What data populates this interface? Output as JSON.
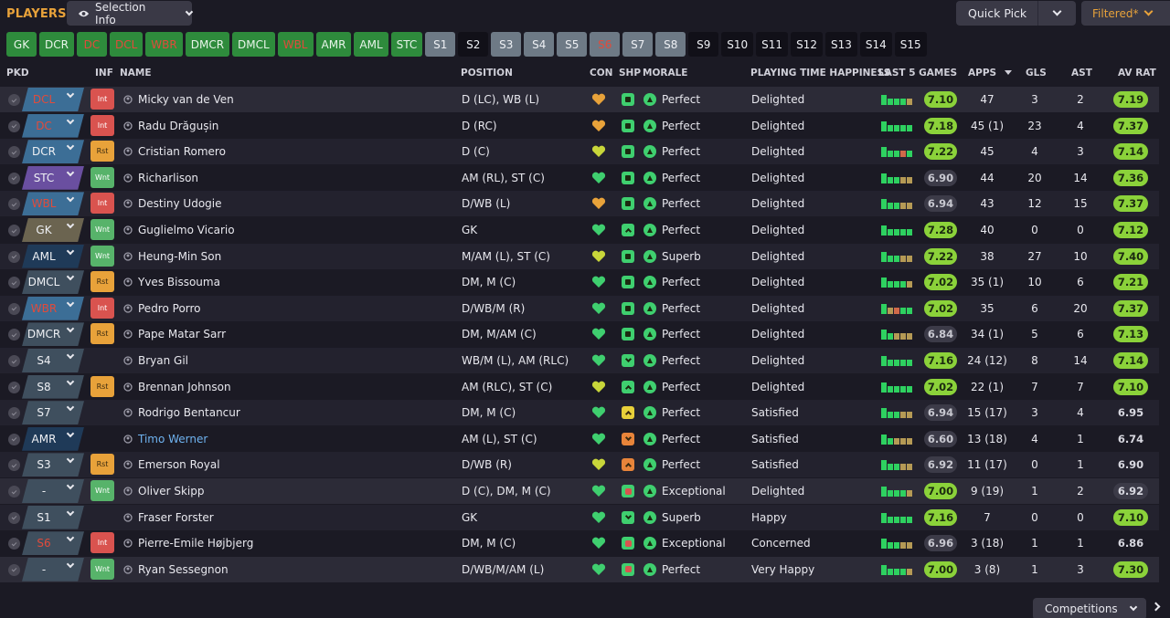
{
  "header": {
    "title": "PLAYERS",
    "selection_info": "Selection Info",
    "quick_pick": "Quick Pick",
    "filtered": "Filtered*"
  },
  "position_buttons": [
    {
      "label": "GK",
      "style": "green"
    },
    {
      "label": "DCR",
      "style": "green"
    },
    {
      "label": "DC",
      "style": "green-red"
    },
    {
      "label": "DCL",
      "style": "green-red"
    },
    {
      "label": "WBR",
      "style": "green-red"
    },
    {
      "label": "DMCR",
      "style": "green"
    },
    {
      "label": "DMCL",
      "style": "green"
    },
    {
      "label": "WBL",
      "style": "green-red"
    },
    {
      "label": "AMR",
      "style": "green"
    },
    {
      "label": "AML",
      "style": "green"
    },
    {
      "label": "STC",
      "style": "green"
    },
    {
      "label": "S1",
      "style": "grey"
    },
    {
      "label": "S2",
      "style": "dark"
    },
    {
      "label": "S3",
      "style": "grey"
    },
    {
      "label": "S4",
      "style": "grey"
    },
    {
      "label": "S5",
      "style": "grey"
    },
    {
      "label": "S6",
      "style": "grey-red"
    },
    {
      "label": "S7",
      "style": "grey"
    },
    {
      "label": "S8",
      "style": "grey"
    },
    {
      "label": "S9",
      "style": "dark"
    },
    {
      "label": "S10",
      "style": "dark"
    },
    {
      "label": "S11",
      "style": "dark"
    },
    {
      "label": "S12",
      "style": "dark"
    },
    {
      "label": "S13",
      "style": "dark"
    },
    {
      "label": "S14",
      "style": "dark"
    },
    {
      "label": "S15",
      "style": "dark"
    }
  ],
  "columns": {
    "pkd": "PKD",
    "inf": "INF",
    "name": "NAME",
    "position": "POSITION",
    "con": "CON",
    "shp": "SHP",
    "morale": "MORALE",
    "pth": "PLAYING TIME HAPPINESS",
    "last5": "LAST 5 GAMES",
    "apps": "APPS",
    "gls": "GLS",
    "ast": "AST",
    "avr": "AV RAT"
  },
  "colors": {
    "green": "#2e8b3c",
    "grey": "#6e7a86",
    "accent": "#e8a23a",
    "rating": "#8bd23a",
    "pos_blue": "#3c6e96",
    "pos_purple": "#6a4fa0",
    "pos_olive": "#6b6450",
    "pos_navy": "#1f3a58",
    "pos_dark": "#3f4f5e"
  },
  "players": [
    {
      "pos": "DCL",
      "pos_color": "#3c6e96",
      "pos_red": true,
      "inf": "Int",
      "name": "Micky van de Ven",
      "position": "D (LC), WB (L)",
      "con": "heart-orange",
      "shp": "green",
      "morale": "Perfect",
      "pth": "Delighted",
      "bars": [
        "#2ed160",
        "#2ed160",
        "#2ed160",
        "#2ed160",
        "#b59a55"
      ],
      "last5": "7.10",
      "last5_style": "green",
      "apps": "47",
      "gls": "3",
      "ast": "2",
      "avr": "7.19",
      "avr_style": "green"
    },
    {
      "pos": "DC",
      "pos_color": "#3c6e96",
      "pos_red": true,
      "inf": "Int",
      "name": "Radu Drăgușin",
      "position": "D (RC)",
      "con": "heart-orange",
      "shp": "green",
      "morale": "Perfect",
      "pth": "Delighted",
      "bars": [
        "#2ed160",
        "#2ed160",
        "#2ed160",
        "#2ed160",
        "#2ed160"
      ],
      "last5": "7.18",
      "last5_style": "green",
      "apps": "45 (1)",
      "gls": "23",
      "ast": "4",
      "avr": "7.37",
      "avr_style": "green"
    },
    {
      "pos": "DCR",
      "pos_color": "#3c6e96",
      "pos_red": false,
      "inf": "Rst",
      "name": "Cristian Romero",
      "position": "D (C)",
      "con": "heart-yellow",
      "shp": "green",
      "morale": "Perfect",
      "pth": "Delighted",
      "bars": [
        "#2ed160",
        "#2ed160",
        "#2ed160",
        "#d06a4a",
        "#2ed160"
      ],
      "last5": "7.22",
      "last5_style": "green",
      "apps": "45",
      "gls": "4",
      "ast": "3",
      "avr": "7.14",
      "avr_style": "green"
    },
    {
      "pos": "STC",
      "pos_color": "#6a4fa0",
      "pos_red": false,
      "inf": "Wnt",
      "name": "Richarlison",
      "position": "AM (RL), ST (C)",
      "con": "heart-green",
      "shp": "green",
      "morale": "Perfect",
      "pth": "Delighted",
      "bars": [
        "#2ed160",
        "#2ed160",
        "#2ed160",
        "#b59a55",
        "#b59a55"
      ],
      "last5": "6.90",
      "last5_style": "grey",
      "apps": "44",
      "gls": "20",
      "ast": "14",
      "avr": "7.36",
      "avr_style": "green"
    },
    {
      "pos": "WBL",
      "pos_color": "#3c6e96",
      "pos_red": true,
      "inf": "Int",
      "name": "Destiny Udogie",
      "position": "D/WB (L)",
      "con": "heart-orange",
      "shp": "green",
      "morale": "Perfect",
      "pth": "Delighted",
      "bars": [
        "#2ed160",
        "#2ed160",
        "#2ed160",
        "#b59a55",
        "#b59a55"
      ],
      "last5": "6.94",
      "last5_style": "grey",
      "apps": "43",
      "gls": "12",
      "ast": "15",
      "avr": "7.37",
      "avr_style": "green"
    },
    {
      "pos": "GK",
      "pos_color": "#6b6450",
      "pos_red": false,
      "inf": "Wnt",
      "name": "Guglielmo Vicario",
      "position": "GK",
      "con": "heart-green",
      "shp": "up",
      "morale": "Perfect",
      "pth": "Delighted",
      "bars": [
        "#2ed160",
        "#2ed160",
        "#2ed160",
        "#2ed160",
        "#2ed160"
      ],
      "last5": "7.28",
      "last5_style": "green",
      "apps": "40",
      "gls": "0",
      "ast": "0",
      "avr": "7.12",
      "avr_style": "green"
    },
    {
      "pos": "AML",
      "pos_color": "#1f3a58",
      "pos_red": false,
      "inf": "Wnt",
      "name": "Heung-Min Son",
      "position": "M/AM (L), ST (C)",
      "con": "heart-yellow",
      "shp": "green",
      "morale": "Superb",
      "pth": "Delighted",
      "bars": [
        "#2ed160",
        "#2ed160",
        "#2ed160",
        "#b59a55",
        "#b59a55"
      ],
      "last5": "7.22",
      "last5_style": "green",
      "apps": "38",
      "gls": "27",
      "ast": "10",
      "avr": "7.40",
      "avr_style": "green"
    },
    {
      "pos": "DMCL",
      "pos_color": "#3f4f5e",
      "pos_red": false,
      "inf": "Rst",
      "name": "Yves Bissouma",
      "position": "DM, M (C)",
      "con": "heart-green",
      "shp": "green",
      "morale": "Perfect",
      "pth": "Delighted",
      "bars": [
        "#2ed160",
        "#2ed160",
        "#2ed160",
        "#2ed160",
        "#b59a55"
      ],
      "last5": "7.02",
      "last5_style": "green",
      "apps": "35 (1)",
      "gls": "10",
      "ast": "6",
      "avr": "7.21",
      "avr_style": "green"
    },
    {
      "pos": "WBR",
      "pos_color": "#3c6e96",
      "pos_red": true,
      "inf": "Int",
      "name": "Pedro Porro",
      "position": "D/WB/M (R)",
      "con": "heart-green",
      "shp": "green",
      "morale": "Perfect",
      "pth": "Delighted",
      "bars": [
        "#2ed160",
        "#b59a55",
        "#d06a4a",
        "#2ed160",
        "#2ed160"
      ],
      "last5": "7.02",
      "last5_style": "green",
      "apps": "35",
      "gls": "6",
      "ast": "20",
      "avr": "7.37",
      "avr_style": "green"
    },
    {
      "pos": "DMCR",
      "pos_color": "#3f4f5e",
      "pos_red": false,
      "inf": "Rst",
      "name": "Pape Matar Sarr",
      "position": "DM, M/AM (C)",
      "con": "heart-green",
      "shp": "green",
      "morale": "Perfect",
      "pth": "Delighted",
      "bars": [
        "#2ed160",
        "#2ed160",
        "#b59a55",
        "#b59a55",
        "#b59a55"
      ],
      "last5": "6.84",
      "last5_style": "grey",
      "apps": "34 (1)",
      "gls": "5",
      "ast": "6",
      "avr": "7.13",
      "avr_style": "green"
    },
    {
      "pos": "S4",
      "pos_color": "#3f4f5e",
      "pos_red": false,
      "inf": "",
      "name": "Bryan Gil",
      "position": "WB/M (L), AM (RLC)",
      "con": "heart-green",
      "shp": "down",
      "morale": "Perfect",
      "pth": "Delighted",
      "bars": [
        "#2ed160",
        "#2ed160",
        "#2ed160",
        "#2ed160",
        "#2ed160"
      ],
      "last5": "7.16",
      "last5_style": "green",
      "apps": "24 (12)",
      "gls": "8",
      "ast": "14",
      "avr": "7.14",
      "avr_style": "green"
    },
    {
      "pos": "S8",
      "pos_color": "#3f4f5e",
      "pos_red": false,
      "inf": "Rst",
      "name": "Brennan Johnson",
      "position": "AM (RLC), ST (C)",
      "con": "heart-yellow",
      "shp": "up",
      "morale": "Perfect",
      "pth": "Delighted",
      "bars": [
        "#2ed160",
        "#2ed160",
        "#2ed160",
        "#2ed160",
        "#2ed160"
      ],
      "last5": "7.02",
      "last5_style": "green",
      "apps": "22 (1)",
      "gls": "7",
      "ast": "7",
      "avr": "7.10",
      "avr_style": "green"
    },
    {
      "pos": "S7",
      "pos_color": "#3f4f5e",
      "pos_red": false,
      "inf": "",
      "name": "Rodrigo Bentancur",
      "position": "DM, M (C)",
      "con": "heart-green",
      "shp": "yellow-up",
      "morale": "Perfect",
      "pth": "Satisfied",
      "bars": [
        "#2ed160",
        "#2ed160",
        "#2ed160",
        "#b59a55",
        "#b59a55"
      ],
      "last5": "6.94",
      "last5_style": "grey",
      "apps": "15 (17)",
      "gls": "3",
      "ast": "4",
      "avr": "6.95",
      "avr_style": "plain"
    },
    {
      "pos": "AMR",
      "pos_color": "#1f3a58",
      "pos_red": false,
      "inf": "",
      "name": "Timo Werner",
      "name_blue": true,
      "position": "AM (L), ST (C)",
      "con": "heart-green",
      "shp": "orange-down",
      "morale": "Perfect",
      "pth": "Satisfied",
      "bars": [
        "#2ed160",
        "#2ed160",
        "#b59a55",
        "#b59a55",
        "#b59a55"
      ],
      "last5": "6.60",
      "last5_style": "grey",
      "apps": "13 (18)",
      "gls": "4",
      "ast": "1",
      "avr": "6.74",
      "avr_style": "plain"
    },
    {
      "pos": "S3",
      "pos_color": "#3f4f5e",
      "pos_red": false,
      "inf": "Rst",
      "name": "Emerson Royal",
      "position": "D/WB (R)",
      "con": "heart-yellow",
      "shp": "orange-up",
      "morale": "Perfect",
      "pth": "Satisfied",
      "bars": [
        "#2ed160",
        "#2ed160",
        "#2ed160",
        "#b59a55",
        "#b59a55"
      ],
      "last5": "6.92",
      "last5_style": "grey",
      "apps": "11 (17)",
      "gls": "0",
      "ast": "1",
      "avr": "6.90",
      "avr_style": "plain"
    },
    {
      "pos": "-",
      "pos_color": "#3f4f5e",
      "pos_red": false,
      "inf": "Wnt",
      "name": "Oliver Skipp",
      "position": "D (C), DM, M (C)",
      "con": "heart-green",
      "shp": "red",
      "morale": "Exceptional",
      "pth": "Delighted",
      "bars": [
        "#2ed160",
        "#2ed160",
        "#2ed160",
        "#2ed160",
        "#b59a55"
      ],
      "last5": "7.00",
      "last5_style": "green",
      "apps": "9 (19)",
      "gls": "1",
      "ast": "2",
      "avr": "6.92",
      "avr_style": "grey"
    },
    {
      "pos": "S1",
      "pos_color": "#3f4f5e",
      "pos_red": false,
      "inf": "",
      "name": "Fraser Forster",
      "position": "GK",
      "con": "heart-green",
      "shp": "down",
      "morale": "Superb",
      "pth": "Happy",
      "bars": [
        "#2ed160",
        "#2ed160",
        "#2ed160",
        "#2ed160",
        "#2ed160"
      ],
      "last5": "7.16",
      "last5_style": "green",
      "apps": "7",
      "gls": "0",
      "ast": "0",
      "avr": "7.10",
      "avr_style": "green"
    },
    {
      "pos": "S6",
      "pos_color": "#3f4f5e",
      "pos_red": true,
      "inf": "Int",
      "name": "Pierre-Emile Højbjerg",
      "position": "DM, M (C)",
      "con": "heart-green",
      "shp": "red",
      "morale": "Exceptional",
      "pth": "Concerned",
      "bars": [
        "#2ed160",
        "#2ed160",
        "#2ed160",
        "#b59a55",
        "#b59a55"
      ],
      "last5": "6.96",
      "last5_style": "grey",
      "apps": "3 (18)",
      "gls": "1",
      "ast": "1",
      "avr": "6.86",
      "avr_style": "plain"
    },
    {
      "pos": "-",
      "pos_color": "#3f4f5e",
      "pos_red": false,
      "inf": "Wnt",
      "name": "Ryan Sessegnon",
      "position": "D/WB/M/AM (L)",
      "con": "heart-green",
      "shp": "red",
      "morale": "Perfect",
      "pth": "Very Happy",
      "bars": [
        "#2ed160",
        "#2ed160",
        "#2ed160",
        "#2ed160",
        "#b59a55"
      ],
      "last5": "7.00",
      "last5_style": "green",
      "apps": "3 (8)",
      "gls": "1",
      "ast": "3",
      "avr": "7.30",
      "avr_style": "green"
    }
  ],
  "footer": {
    "competitions": "Competitions"
  }
}
